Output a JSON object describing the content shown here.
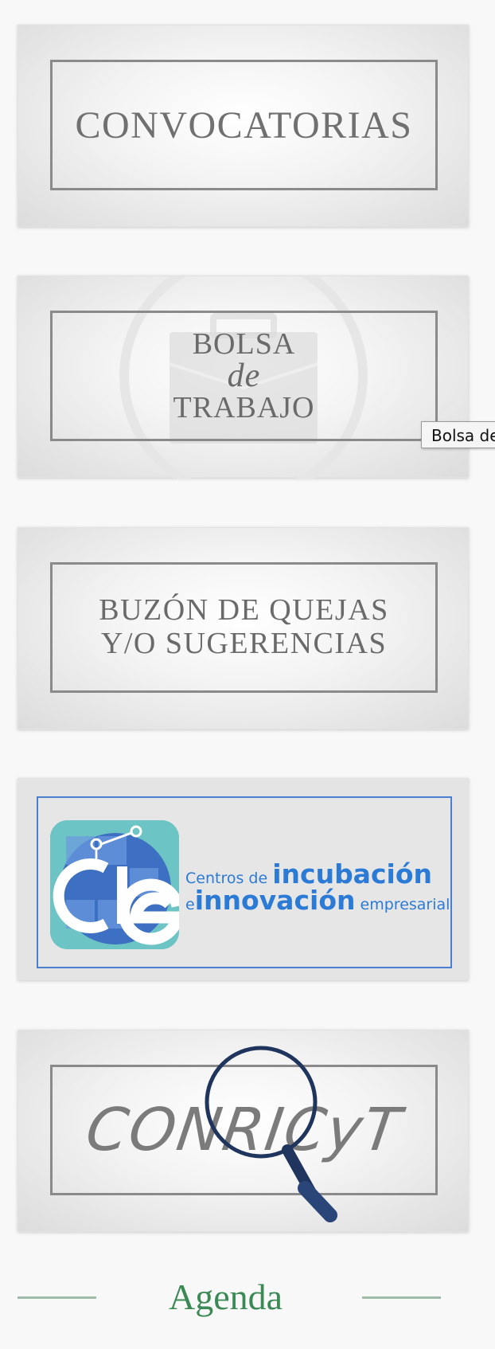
{
  "banners": {
    "convocatorias": {
      "label": "CONVOCATORIAS"
    },
    "bolsa": {
      "line1": "BOLSA",
      "line2": "de",
      "line3": "TRABAJO",
      "icon": "briefcase-icon"
    },
    "buzon": {
      "line1": "BUZÓN DE QUEJAS",
      "line2": "Y/O SUGERENCIAS"
    },
    "cie": {
      "logo_letters": "cie",
      "small1": "Centros de",
      "big1": "incubación",
      "small2": "e",
      "big2": "innovación",
      "small3": "empresarial",
      "colors": {
        "blue": "#2b7bd6",
        "teal": "#6cc4c4",
        "navy": "#1d3f86"
      }
    },
    "conricyt": {
      "label": "CONRICyT",
      "icon": "magnifier-icon"
    }
  },
  "tooltip": {
    "text": "Bolsa de"
  },
  "agenda": {
    "title": "Agenda",
    "color": "#3b8a55"
  }
}
